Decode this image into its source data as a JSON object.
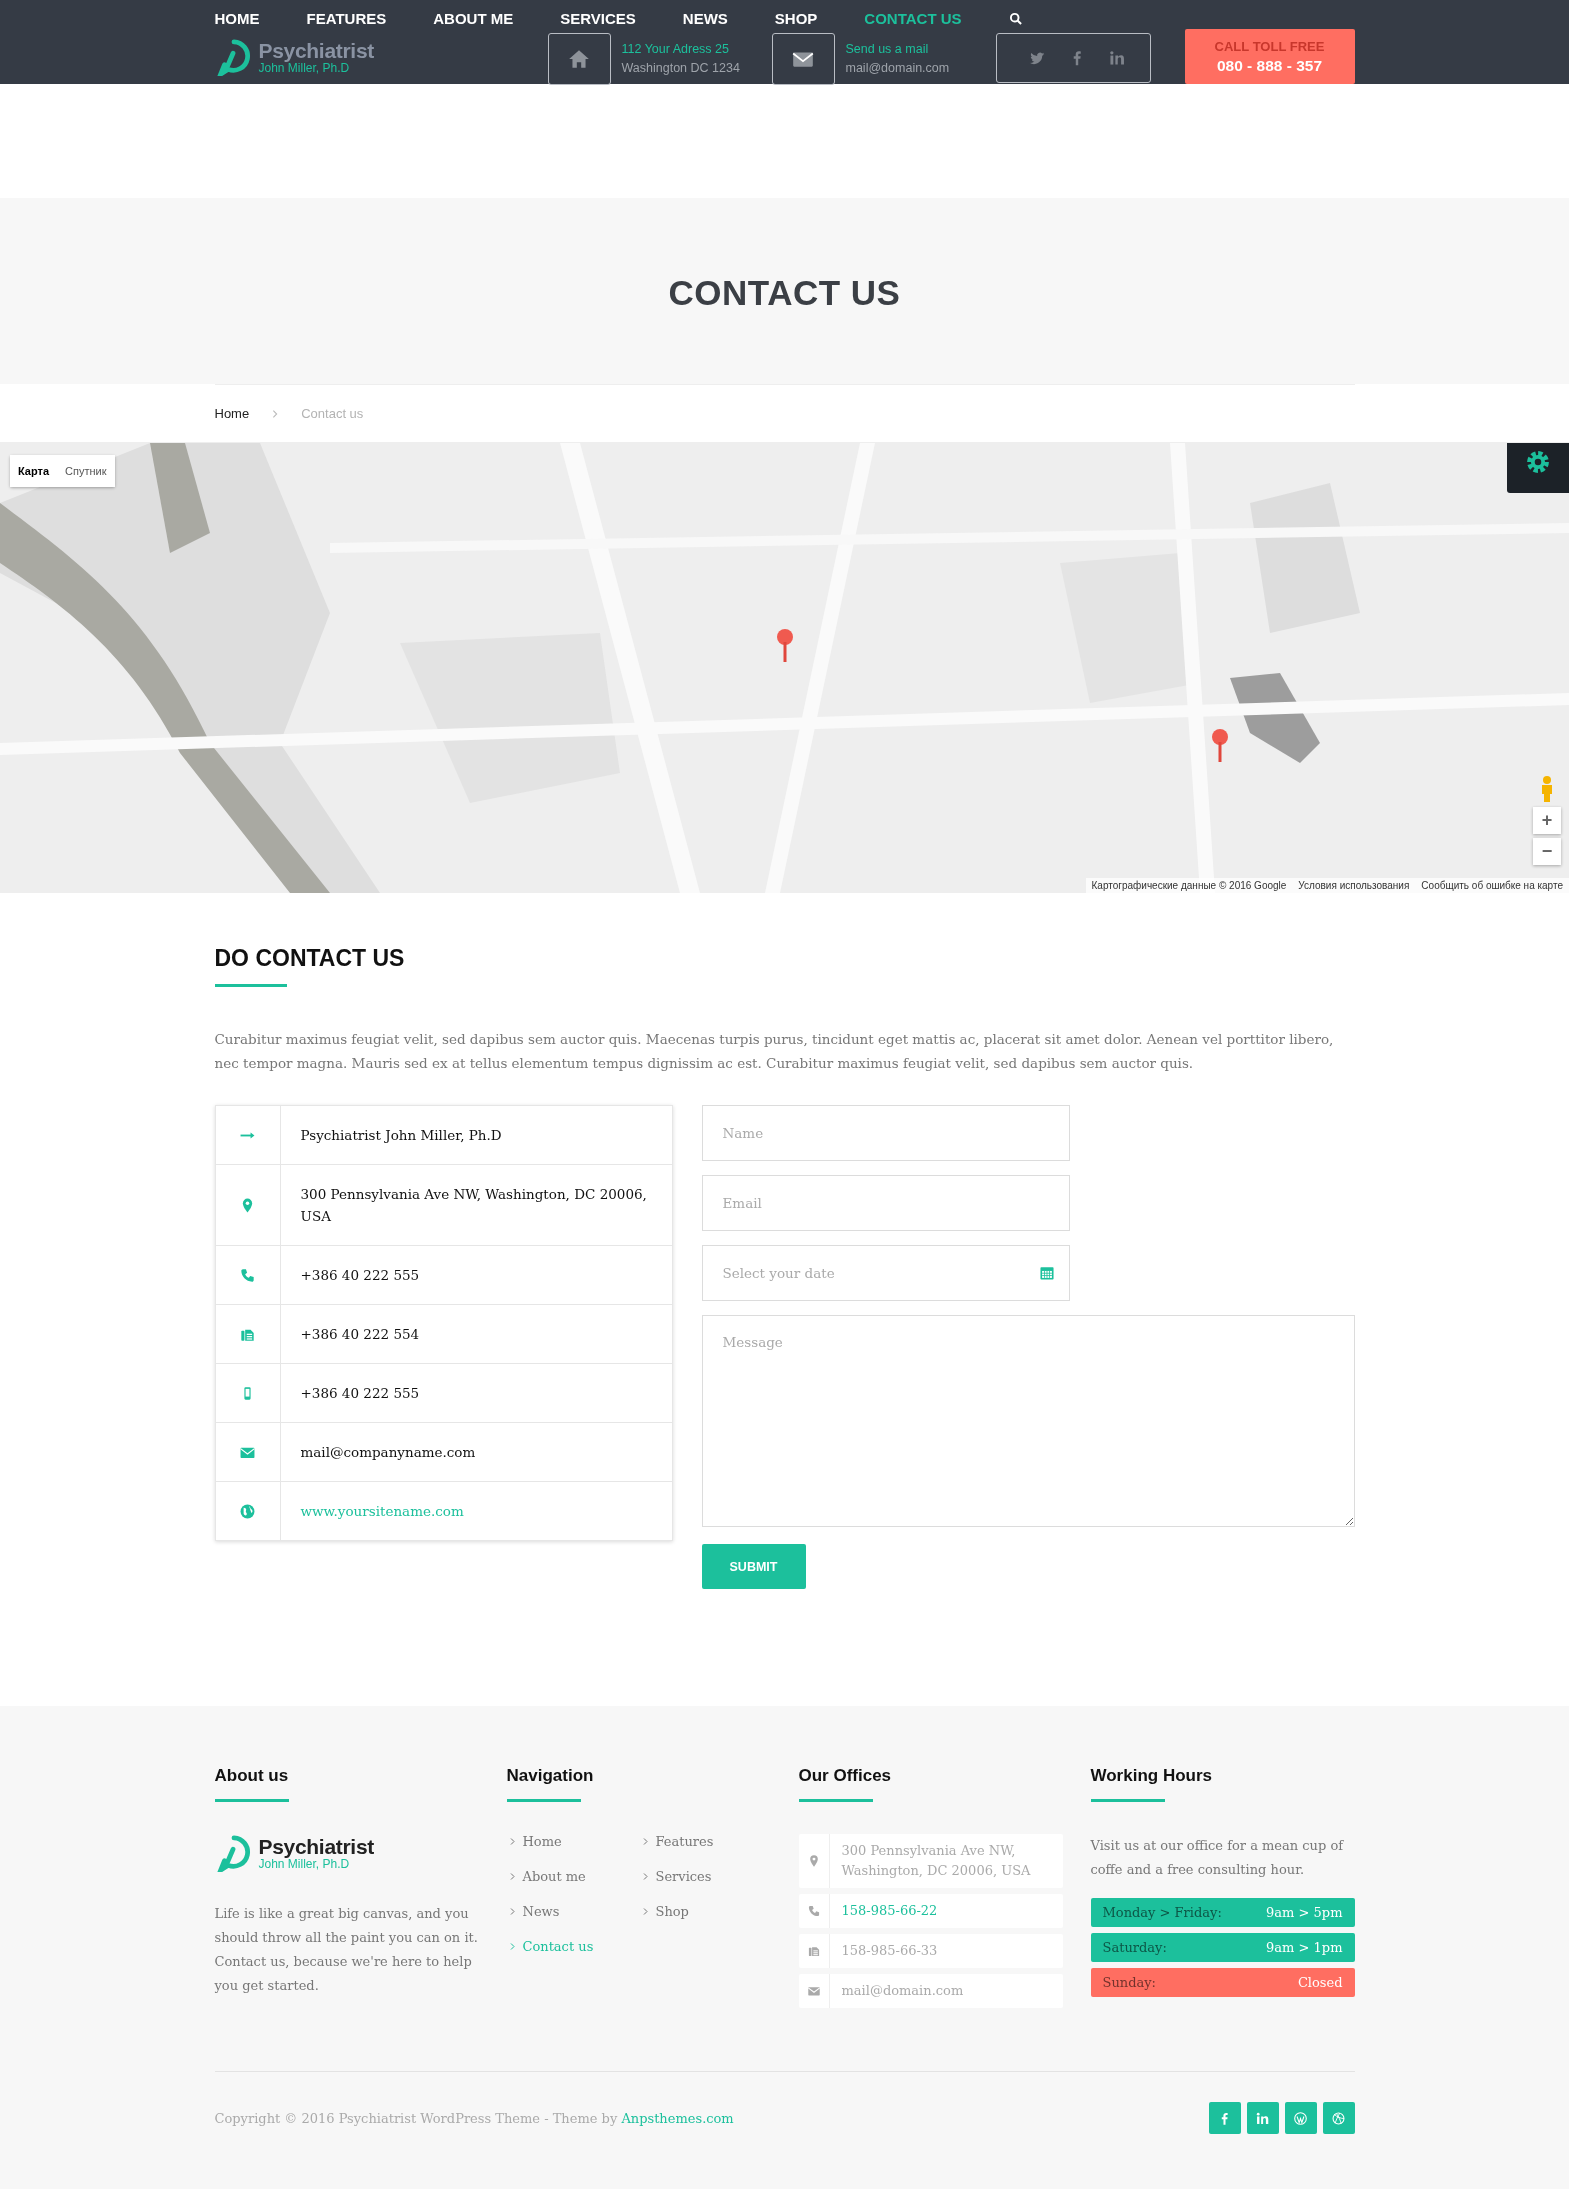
{
  "header": {
    "logo": {
      "name": "Psychiatrist",
      "subtitle": "John Miller, Ph.D"
    },
    "nav": [
      {
        "label": "HOME",
        "selected": false
      },
      {
        "label": "FEATURES",
        "selected": false
      },
      {
        "label": "ABOUT ME",
        "selected": false
      },
      {
        "label": "SERVICES",
        "selected": false
      },
      {
        "label": "NEWS",
        "selected": false
      },
      {
        "label": "SHOP",
        "selected": false
      },
      {
        "label": "CONTACT US",
        "selected": true
      }
    ],
    "address": {
      "title": "112 Your Adress 25",
      "line": "Washington DC 1234"
    },
    "mail": {
      "title": "Send us a mail",
      "line": "mail@domain.com"
    },
    "call": {
      "label": "CALL TOLL FREE",
      "number": "080 - 888 - 357"
    }
  },
  "page_title": "CONTACT US",
  "breadcrumb": [
    {
      "label": "Home",
      "selected": false
    },
    {
      "label": "Contact us",
      "selected": true
    }
  ],
  "map": {
    "map_types": [
      {
        "label": "Карта",
        "selected": true
      },
      {
        "label": "Спутник",
        "selected": false
      }
    ],
    "zoom_controls": [
      "+",
      "−"
    ],
    "attribution": [
      "Картографические данные © 2016 Google",
      "Условия использования",
      "Сообщить об ошибке на карте"
    ]
  },
  "contact": {
    "heading": "DO CONTACT US",
    "intro": "Curabitur maximus feugiat velit, sed dapibus sem auctor quis. Maecenas turpis purus, tincidunt eget mattis ac, placerat sit amet dolor. Aenean vel porttitor libero, nec tempor magna. Mauris sed ex at tellus elementum tempus dignissim ac est. Curabitur maximus feugiat velit, sed dapibus sem auctor quis.",
    "details": [
      {
        "kind": "arrow",
        "text": "Psychiatrist John Miller, Ph.D",
        "link": false
      },
      {
        "kind": "pin",
        "text": "300 Pennsylvania Ave NW, Washington, DC 20006, USA",
        "link": false
      },
      {
        "kind": "phone",
        "text": "+386 40 222 555",
        "link": false
      },
      {
        "kind": "fax",
        "text": "+386 40 222 554",
        "link": false
      },
      {
        "kind": "mobile",
        "text": "+386 40 222 555",
        "link": false
      },
      {
        "kind": "mail",
        "text": "mail@companyname.com",
        "link": false
      },
      {
        "kind": "globe",
        "text": "www.yoursitename.com",
        "link": true
      }
    ],
    "form": {
      "fields": [
        {
          "kind": "text",
          "placeholder": "Name"
        },
        {
          "kind": "text",
          "placeholder": "Email"
        },
        {
          "kind": "date",
          "placeholder": "Select your date"
        },
        {
          "kind": "textarea",
          "placeholder": "Message"
        }
      ],
      "submit": "SUBMIT"
    }
  },
  "footer": {
    "about": {
      "heading": "About us",
      "logo": {
        "name": "Psychiatrist",
        "subtitle": "John Miller, Ph.D"
      },
      "text": "Life is like a great big canvas, and you should throw all the paint you can on it. Contact us, because we're here to help you get started."
    },
    "navigation": {
      "heading": "Navigation",
      "items": [
        {
          "label": "Home",
          "selected": false
        },
        {
          "label": "Features",
          "selected": false
        },
        {
          "label": "About me",
          "selected": false
        },
        {
          "label": "Services",
          "selected": false
        },
        {
          "label": "News",
          "selected": false
        },
        {
          "label": "Shop",
          "selected": false
        },
        {
          "label": "Contact us",
          "selected": true
        }
      ]
    },
    "offices": {
      "heading": "Our Offices",
      "items": [
        {
          "kind": "pin",
          "text": "300 Pennsylvania Ave NW, Washington, DC 20006, USA",
          "highlighted": false
        },
        {
          "kind": "phone",
          "text": "158-985-66-22",
          "highlighted": true
        },
        {
          "kind": "fax",
          "text": "158-985-66-33",
          "highlighted": false
        },
        {
          "kind": "mail",
          "text": "mail@domain.com",
          "highlighted": false
        }
      ]
    },
    "hours": {
      "heading": "Working Hours",
      "text": "Visit us at our office for a mean cup of coffe and a free consulting hour.",
      "rows": [
        {
          "day": "Monday > Friday:",
          "time": "9am > 5pm",
          "color": "#1cc09c"
        },
        {
          "day": "Saturday:",
          "time": "9am > 1pm",
          "color": "#1cc09c"
        },
        {
          "day": "Sunday:",
          "time": "Closed",
          "color": "#ff6e61"
        }
      ]
    },
    "copyright": "Copyright © 2016 Psychiatrist WordPress Theme - Theme by",
    "credit_link": "Anpsthemes.com"
  }
}
